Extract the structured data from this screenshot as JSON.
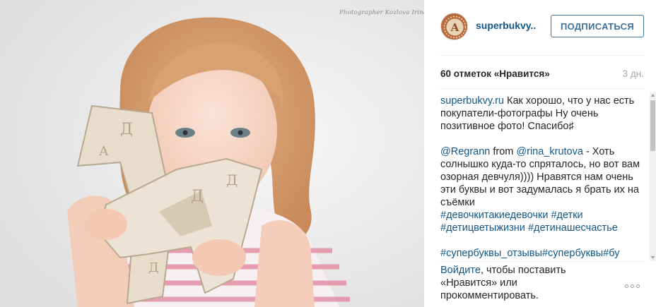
{
  "photo": {
    "credit": "Photographer  Kozlova Irina",
    "letter_glyph": "Д",
    "small_glyphs": [
      "Д",
      "А",
      "Д",
      "Д",
      "Д"
    ]
  },
  "header": {
    "username": "superbukvy..",
    "follow_label": "ПОДПИСАТЬСЯ",
    "avatar_letter": "А"
  },
  "stats": {
    "likes": "60 отметок «Нравится»",
    "ago": "3 дн."
  },
  "caption": {
    "author": "superbukvy.ru",
    "text1": " Как хорошо, что у нас есть покупатели-фотографы",
    "box1": "",
    "text2": " Ну очень позитивное фото! Спасибо",
    "smile": "♯",
    "mention1": "@Regrann",
    "from_word": " from ",
    "mention2": "@rina_krutova",
    "text3": " - Хоть солнышко куда-то спряталось, но вот вам озорная девчуля)))) Нравятся нам очень эти буквы и вот задумалась я брать их на съёмки ",
    "boxes": "",
    "tags1": [
      "#девочкитакиедевочки",
      "#детки"
    ],
    "tags2": [
      "#детицветыжизни",
      "#детинашесчастье"
    ],
    "tags3": [
      "#супербуквы_отзывы",
      "#супербуквы",
      "#бу"
    ]
  },
  "footer": {
    "login_link": "Войдите",
    "text": ", чтобы поставить «Нравится» или прокомментировать.",
    "more_icon": "ellipsis-icon"
  },
  "colors": {
    "link": "#125688",
    "follow": "#3f729b",
    "muted": "#a5a7aa",
    "text": "#262626"
  }
}
